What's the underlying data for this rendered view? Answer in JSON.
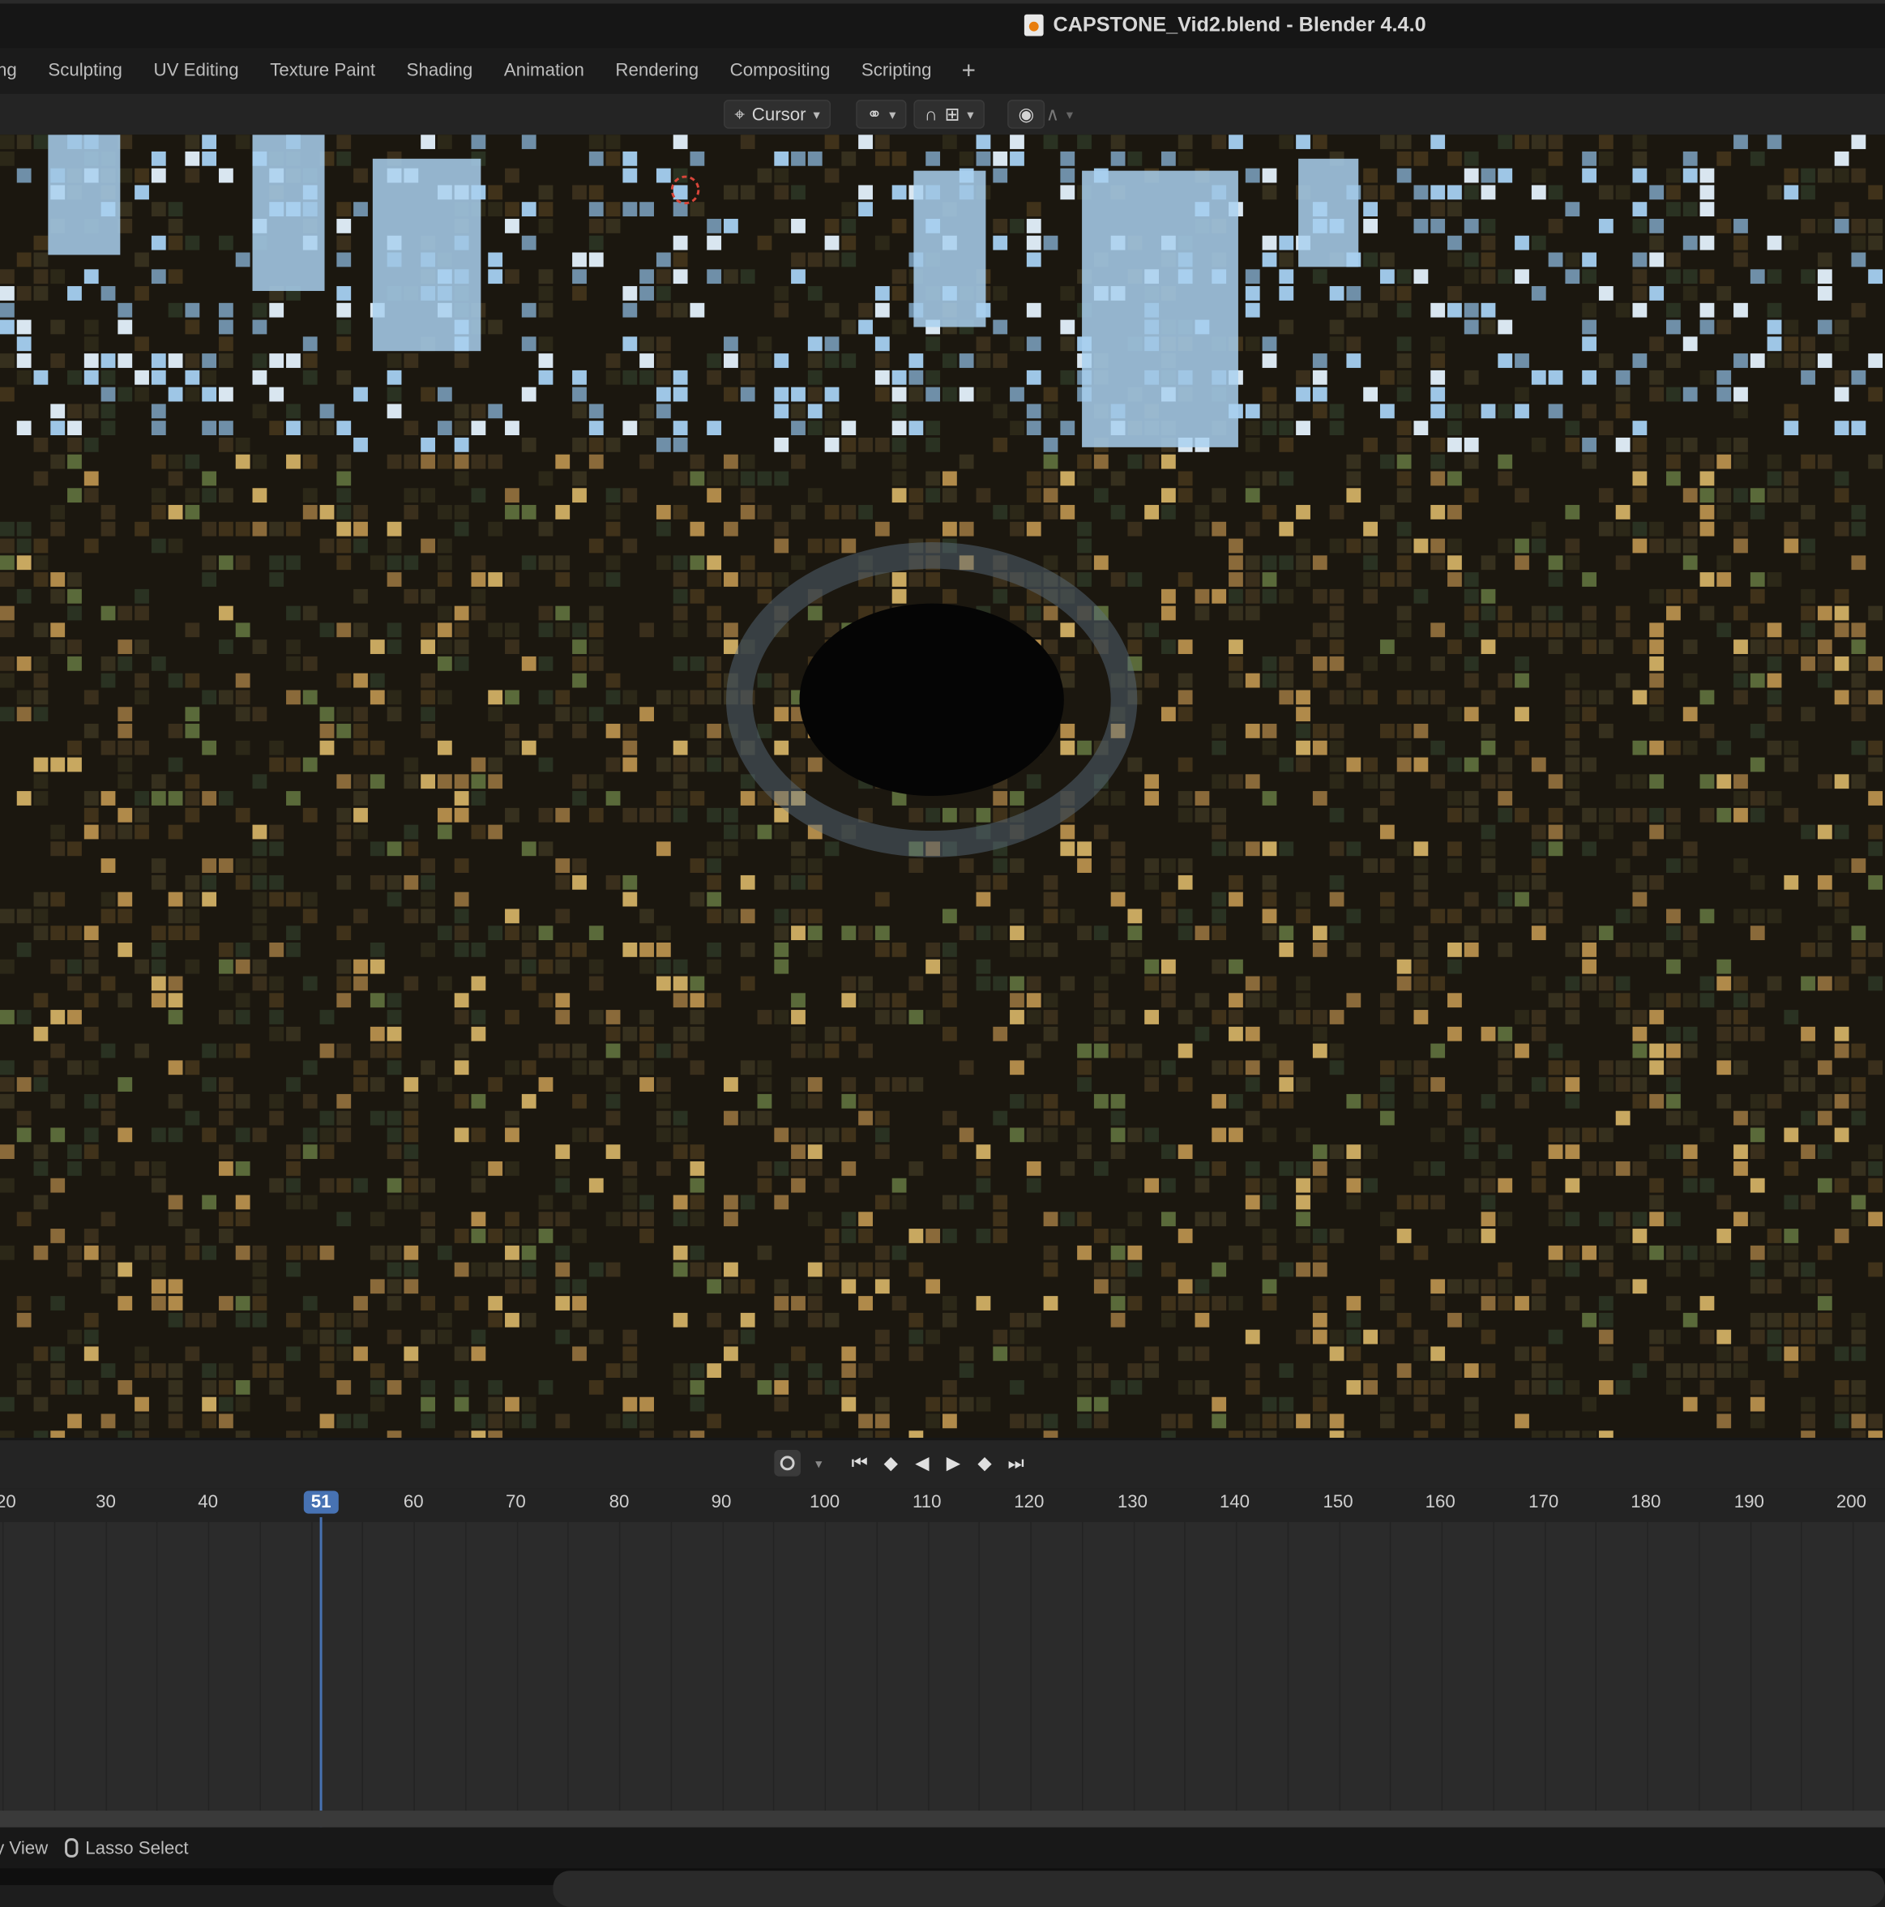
{
  "window": {
    "title": "CAPSTONE_Vid2.blend - Blender 4.4.0"
  },
  "workspace_tabs": [
    "ing",
    "Sculpting",
    "UV Editing",
    "Texture Paint",
    "Shading",
    "Animation",
    "Rendering",
    "Compositing",
    "Scripting"
  ],
  "viewport_header": {
    "pivot_label": "Cursor"
  },
  "timeline": {
    "current_frame": "51",
    "ticks": [
      "20",
      "30",
      "40",
      "60",
      "70",
      "80",
      "90",
      "100",
      "110",
      "120",
      "130",
      "140",
      "150",
      "160",
      "170",
      "180",
      "190",
      "200"
    ]
  },
  "status_bar": {
    "left_text": "y View",
    "lasso_label": "Lasso Select"
  }
}
